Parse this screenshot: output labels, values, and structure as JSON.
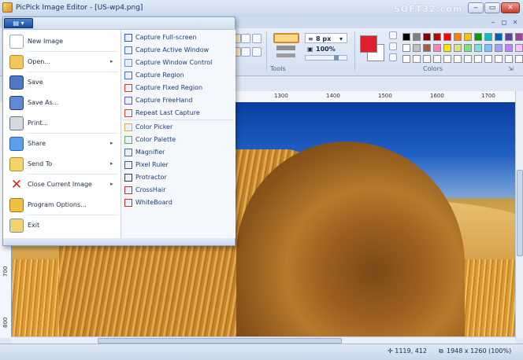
{
  "window": {
    "title": "PicPick Image Editor - [US-wp4.png]",
    "watermark": "SOFT32.com",
    "controls": [
      "‒",
      "▭",
      "✕"
    ]
  },
  "ribbon": {
    "app_button": "▤ ▾",
    "mdi_controls": [
      "‒",
      "◻",
      "✕"
    ],
    "tools_label": "Tools",
    "colors_label": "Colors",
    "stroke_size": "8 px",
    "zoom": "100%",
    "palette": [
      "#000000",
      "#808080",
      "#800000",
      "#c00000",
      "#ff0000",
      "#ff8000",
      "#ffc000",
      "#00a000",
      "#00c0c0",
      "#0060c0",
      "#6040a0",
      "#a040a0",
      "#ffffff",
      "#c0c0c0",
      "#a06040",
      "#ff80c0",
      "#ffe000",
      "#e0e080",
      "#80e080",
      "#80e0e0",
      "#80c0ff",
      "#a0a0ff",
      "#c080ff",
      "#ffc0ff",
      "#ffffff",
      "#ffffff",
      "#ffffff",
      "#ffffff",
      "#ffffff",
      "#ffffff",
      "#ffffff",
      "#ffffff",
      "#ffffff",
      "#ffffff",
      "#ffffff",
      "#ffffff"
    ],
    "primary_color": "#e0202c",
    "secondary_color": "#ffffff"
  },
  "ruler": {
    "h_labels": [
      "1300",
      "1400",
      "1500",
      "1600",
      "1700"
    ],
    "v_labels": [
      "700",
      "800"
    ]
  },
  "status": {
    "cursor": "✛ 1119, 412",
    "size": "1948 x 1260  (100%)"
  },
  "appmenu": {
    "left_items": [
      {
        "label": "New Image",
        "icon": "new-image-icon",
        "arrow": ""
      },
      {
        "label": "Open...",
        "icon": "open-folder-icon",
        "arrow": "▸"
      },
      {
        "label": "Save",
        "icon": "save-icon",
        "arrow": ""
      },
      {
        "label": "Save As...",
        "icon": "save-as-icon",
        "arrow": ""
      },
      {
        "label": "Print...",
        "icon": "printer-icon",
        "arrow": ""
      },
      {
        "label": "Share",
        "icon": "share-icon",
        "arrow": "▸"
      },
      {
        "label": "Send To",
        "icon": "send-to-icon",
        "arrow": "▸"
      },
      {
        "label": "Close Current Image",
        "icon": "close-image-icon",
        "arrow": "▸"
      },
      {
        "label": "Program Options...",
        "icon": "options-icon",
        "arrow": ""
      },
      {
        "label": "Exit",
        "icon": "exit-icon",
        "arrow": ""
      }
    ],
    "right_items": [
      {
        "label": "Capture Full-screen",
        "icon": "capture-fullscreen-icon"
      },
      {
        "label": "Capture Active Window",
        "icon": "capture-window-icon"
      },
      {
        "label": "Capture Window Control",
        "icon": "capture-control-icon"
      },
      {
        "label": "Capture Region",
        "icon": "capture-region-icon"
      },
      {
        "label": "Capture Fixed Region",
        "icon": "capture-fixed-region-icon"
      },
      {
        "label": "Capture FreeHand",
        "icon": "capture-freehand-icon"
      },
      {
        "label": "Repeat Last Capture",
        "icon": "repeat-capture-icon"
      },
      {
        "label": "Color Picker",
        "icon": "color-picker-icon"
      },
      {
        "label": "Color Palette",
        "icon": "color-palette-icon"
      },
      {
        "label": "Magnifier",
        "icon": "magnifier-icon"
      },
      {
        "label": "Pixel Ruler",
        "icon": "pixel-ruler-icon"
      },
      {
        "label": "Protractor",
        "icon": "protractor-icon"
      },
      {
        "label": "CrossHair",
        "icon": "crosshair-icon"
      },
      {
        "label": "WhiteBoard",
        "icon": "whiteboard-icon"
      }
    ]
  }
}
